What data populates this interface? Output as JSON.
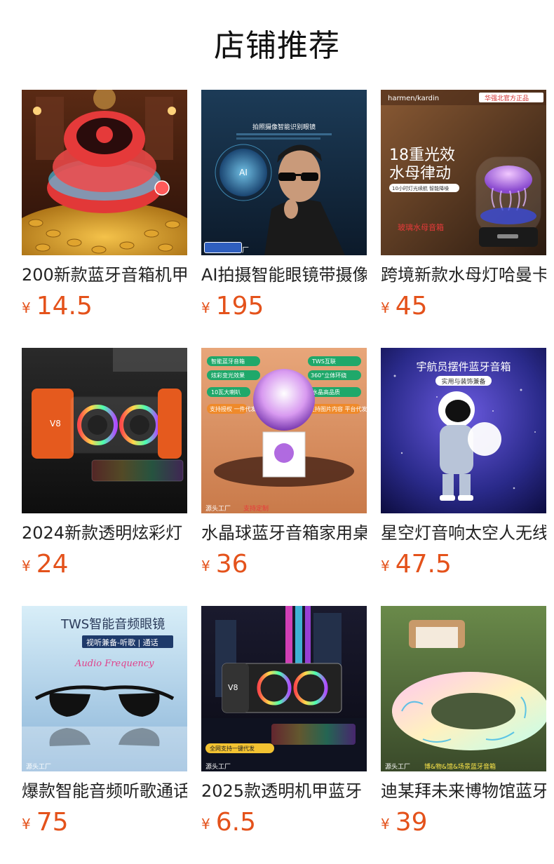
{
  "header": {
    "title": "店铺推荐"
  },
  "currency_symbol": "¥",
  "products": [
    {
      "name": "200新款蓝牙音箱机甲",
      "price": "14.5",
      "image": "red-speaker-gold-coins",
      "image_texts": []
    },
    {
      "name": "AI拍摄智能眼镜带摄像",
      "price": "195",
      "image": "man-with-smart-glasses",
      "image_texts": [
        "拍照摄像智能识别眼镜",
        "AI",
        "源头工厂"
      ]
    },
    {
      "name": "跨境新款水母灯哈曼卡顿",
      "price": "45",
      "image": "jellyfish-lamp-speaker",
      "image_texts": [
        "harmen/kardin",
        "华强北官方正品",
        "18重光效",
        "水母律动",
        "10小时灯光续航 智能降噪",
        "玻璃水母音箱"
      ]
    },
    {
      "name": "2024新款透明炫彩灯",
      "price": "24",
      "image": "transparent-rgb-speaker",
      "image_texts": [
        "V8"
      ]
    },
    {
      "name": "水晶球蓝牙音箱家用桌",
      "price": "36",
      "image": "crystal-ball-speaker",
      "image_texts": [
        "智能蓝牙音箱",
        "炫彩变光效果",
        "10瓦大喇叭",
        "支持授权 一件代发",
        "TWS互联",
        "360°立体环绕",
        "水晶高品质",
        "支持图片内容 平台代发",
        "源头工厂",
        "支持定制"
      ]
    },
    {
      "name": "星空灯音响太空人无线",
      "price": "47.5",
      "image": "astronaut-speaker",
      "image_texts": [
        "宇航员摆件蓝牙音箱",
        "实用与装饰兼备"
      ]
    },
    {
      "name": "爆款智能音频听歌通话",
      "price": "75",
      "image": "audio-sunglasses",
      "image_texts": [
        "TWS智能音频眼镜",
        "视听兼备-听歌 | 通话",
        "Audio Frequency",
        "源头工厂"
      ]
    },
    {
      "name": "2025款透明机甲蓝牙",
      "price": "6.5",
      "image": "mecha-speaker-city",
      "image_texts": [
        "V8",
        "全网支持一键代发",
        "源头工厂"
      ]
    },
    {
      "name": "迪某拜未来博物馆蓝牙",
      "price": "39",
      "image": "ring-lamp-speaker",
      "image_texts": [
        "源头工厂",
        "博&物&馆&场景蓝牙音箱"
      ]
    }
  ]
}
